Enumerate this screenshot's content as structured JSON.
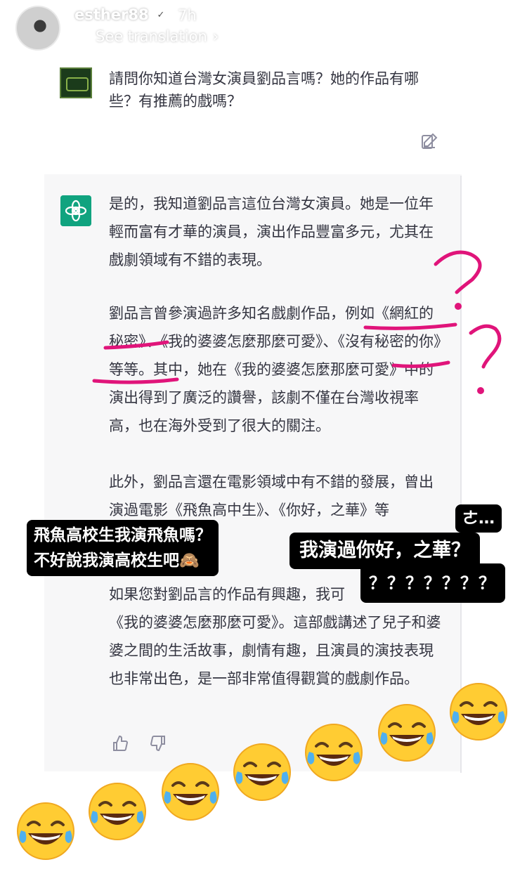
{
  "story": {
    "username": "esther88",
    "verified_badge": "✓",
    "time_ago": "7h",
    "see_translation": "See translation",
    "more": "•••"
  },
  "chat": {
    "question": "請問你知道台灣女演員劉品言嗎？她的作品有哪些？有推薦的戲嗎？",
    "answer_paragraphs": [
      "是的，我知道劉品言這位台灣女演員。她是一位年輕而富有才華的演員，演出作品豐富多元，尤其在戲劇領域有不錯的表現。",
      "劉品言曾參演過許多知名戲劇作品，例如《網紅的秘密》、《我的婆婆怎麼那麼可愛》、《沒有秘密的你》等等。其中，她在《我的婆婆怎麼那麼可愛》中的演出得到了廣泛的讚譽，該劇不僅在台灣收視率高，也在海外受到了很大的關注。",
      "此外，劉品言還在電影領域中有不錯的發展，曾出演過電影《飛魚高中生》、《你好，之華》等",
      "如果您對劉品言的作品有興趣，我可　　　　一下《我的婆婆怎麼那麼可愛》。這部戲講述了兒子和婆婆之間的生活故事，劇情有趣，且演員的演技表現也非常出色，是一部非常值得觀賞的戲劇作品。"
    ]
  },
  "captions": {
    "left_line1": "飛魚高校生我演飛魚嗎？",
    "left_line2": "不好說我演高校生吧🙈",
    "right_top": "ㄜ…",
    "right_main": "我演過你好，之華？",
    "right_q": "？？？？？？？"
  },
  "annotations": {
    "marks": [
      "?",
      "?"
    ],
    "ink_color": "#e0147a"
  },
  "emoji": {
    "name": "face-with-tears-of-joy",
    "count": 7
  },
  "colors": {
    "chatgpt_green": "#10a37f",
    "answer_bg": "#f7f7f8",
    "text": "#343541",
    "caption_bg": "#000000"
  }
}
